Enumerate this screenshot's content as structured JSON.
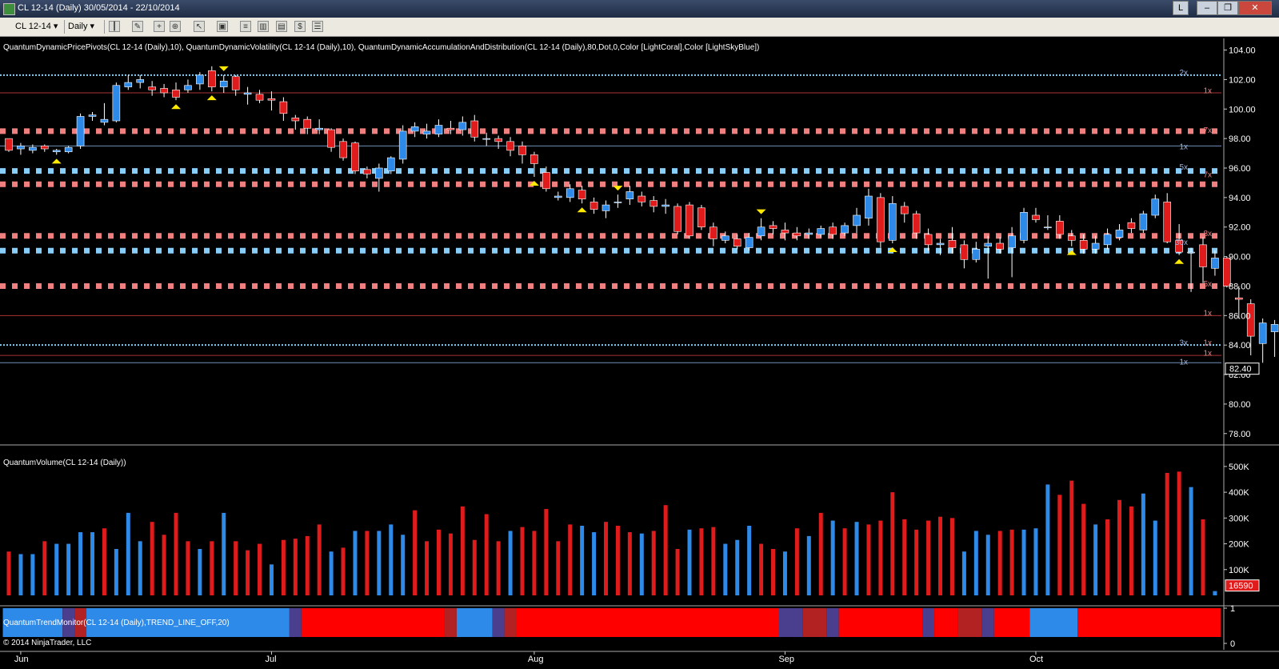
{
  "window": {
    "title": "CL 12-14 (Daily)  30/05/2014 - 22/10/2014",
    "buttons": {
      "layout": "L",
      "minimize": "–",
      "maximize": "❐",
      "close": "✕"
    }
  },
  "toolbar": {
    "instrument": "CL 12-14",
    "instrument_arrow": "▾",
    "period": "Daily",
    "period_arrow": "▾",
    "icons": [
      "bar-style-icon",
      "pencil-icon",
      "crosshair-icon",
      "zoom-icon",
      "pointer-icon",
      "properties-icon",
      "indicators-icon",
      "strategy-icon",
      "data-box-icon",
      "dollar-icon",
      "template-icon"
    ]
  },
  "colors": {
    "up": "#2e8ae8",
    "down": "#e01b1b",
    "coral": "#f08080",
    "skyblue": "#87cefa",
    "trend_red": "#ff0000",
    "trend_blue": "#2e8ae8",
    "trend_purple": "#4a3f8f",
    "trend_maroon": "#b22222"
  },
  "chart_data": [
    {
      "type": "candlestick",
      "title": "QuantumDynamicPricePivots(CL 12-14 (Daily),10), QuantumDynamicVolatility(CL 12-14 (Daily),10), QuantumDynamicAccumulationAndDistribution(CL 12-14 (Daily),80,Dot,0,Color [LightCoral],Color [LightSkyBlue])",
      "ylim": [
        77.5,
        104.3
      ],
      "yticks": [
        "104.00",
        "102.00",
        "100.00",
        "98.00",
        "96.00",
        "94.00",
        "92.00",
        "90.00",
        "88.00",
        "86.00",
        "84.00",
        "82.00",
        "80.00",
        "78.00"
      ],
      "last_price": "82.40",
      "candles": [
        [
          98.0,
          97.2,
          97.6,
          97.1
        ],
        [
          97.3,
          97.5,
          97.7,
          96.9
        ],
        [
          97.2,
          97.4,
          97.6,
          97.0
        ],
        [
          97.5,
          97.3,
          97.6,
          97.1
        ],
        [
          97.1,
          97.2,
          97.3,
          96.9
        ],
        [
          97.1,
          97.4,
          97.5,
          97.0
        ],
        [
          97.5,
          99.5,
          99.7,
          97.3
        ],
        [
          99.5,
          99.6,
          99.8,
          99.2
        ],
        [
          99.1,
          99.3,
          100.4,
          98.9
        ],
        [
          99.2,
          101.6,
          101.8,
          99.1
        ],
        [
          101.5,
          101.8,
          102.3,
          101.3
        ],
        [
          101.8,
          102.0,
          102.3,
          101.4
        ],
        [
          101.5,
          101.3,
          101.9,
          100.9
        ],
        [
          101.4,
          101.1,
          101.7,
          100.8
        ],
        [
          101.3,
          100.8,
          101.8,
          100.6
        ],
        [
          101.3,
          101.6,
          102.0,
          101.1
        ],
        [
          101.7,
          102.3,
          102.5,
          101.3
        ],
        [
          102.6,
          101.5,
          102.9,
          101.2
        ],
        [
          101.5,
          101.9,
          102.3,
          101.1
        ],
        [
          102.2,
          101.3,
          102.3,
          100.9
        ],
        [
          101.0,
          101.1,
          101.5,
          100.3
        ],
        [
          101.0,
          100.6,
          101.3,
          100.4
        ],
        [
          100.7,
          100.6,
          101.2,
          99.9
        ],
        [
          100.5,
          99.7,
          100.8,
          99.2
        ],
        [
          99.4,
          99.2,
          99.6,
          98.6
        ],
        [
          99.3,
          98.7,
          99.5,
          98.3
        ],
        [
          98.6,
          98.7,
          99.3,
          98.3
        ],
        [
          98.6,
          97.4,
          98.7,
          97.1
        ],
        [
          97.8,
          96.7,
          98.0,
          96.5
        ],
        [
          97.7,
          95.8,
          97.8,
          95.6
        ],
        [
          95.9,
          95.6,
          96.1,
          95.3
        ],
        [
          95.3,
          96.0,
          96.3,
          94.4
        ],
        [
          95.8,
          96.7,
          96.8,
          95.6
        ],
        [
          96.6,
          98.5,
          98.9,
          96.3
        ],
        [
          98.5,
          98.8,
          99.1,
          98.1
        ],
        [
          98.3,
          98.5,
          99.0,
          98.0
        ],
        [
          98.3,
          98.9,
          99.3,
          98.1
        ],
        [
          98.7,
          98.6,
          99.2,
          98.3
        ],
        [
          98.6,
          99.1,
          99.5,
          98.2
        ],
        [
          99.2,
          98.1,
          99.6,
          97.8
        ],
        [
          98.0,
          98.0,
          98.4,
          97.5
        ],
        [
          98.0,
          97.8,
          98.2,
          97.3
        ],
        [
          97.8,
          97.2,
          98.1,
          96.8
        ],
        [
          97.5,
          96.9,
          97.8,
          96.3
        ],
        [
          96.9,
          96.3,
          97.1,
          95.4
        ],
        [
          95.7,
          94.6,
          96.1,
          94.4
        ],
        [
          94.0,
          94.1,
          94.4,
          93.8
        ],
        [
          94.0,
          94.6,
          94.9,
          93.7
        ],
        [
          94.5,
          93.9,
          94.8,
          93.6
        ],
        [
          93.7,
          93.2,
          94.0,
          92.9
        ],
        [
          93.1,
          93.5,
          93.8,
          92.6
        ],
        [
          93.7,
          93.7,
          94.2,
          93.3
        ],
        [
          93.9,
          94.4,
          94.8,
          93.5
        ],
        [
          94.1,
          93.7,
          94.4,
          93.4
        ],
        [
          93.8,
          93.4,
          94.1,
          93.0
        ],
        [
          93.4,
          93.5,
          93.9,
          92.9
        ],
        [
          93.4,
          91.7,
          93.6,
          91.5
        ],
        [
          93.5,
          91.4,
          93.7,
          91.2
        ],
        [
          93.3,
          92.0,
          93.5,
          91.8
        ],
        [
          92.0,
          91.2,
          92.3,
          90.7
        ],
        [
          91.1,
          91.4,
          91.7,
          90.9
        ],
        [
          91.2,
          90.7,
          91.5,
          90.5
        ],
        [
          90.6,
          91.3,
          91.6,
          90.4
        ],
        [
          91.4,
          92.0,
          92.6,
          91.1
        ],
        [
          92.1,
          91.9,
          92.4,
          91.5
        ],
        [
          91.8,
          91.6,
          92.3,
          91.1
        ],
        [
          91.6,
          91.4,
          92.0,
          91.1
        ],
        [
          91.5,
          91.6,
          91.9,
          91.2
        ],
        [
          91.5,
          91.9,
          92.1,
          91.3
        ],
        [
          92.0,
          91.5,
          92.3,
          91.2
        ],
        [
          91.6,
          92.1,
          92.3,
          91.4
        ],
        [
          92.1,
          92.8,
          93.3,
          91.6
        ],
        [
          92.6,
          94.1,
          94.6,
          92.1
        ],
        [
          94.0,
          91.0,
          94.3,
          90.6
        ],
        [
          91.1,
          93.6,
          94.1,
          90.9
        ],
        [
          93.4,
          92.9,
          93.7,
          92.3
        ],
        [
          92.9,
          91.6,
          93.1,
          91.2
        ],
        [
          91.5,
          90.8,
          91.9,
          90.4
        ],
        [
          90.8,
          90.9,
          91.2,
          90.1
        ],
        [
          91.1,
          90.6,
          92.0,
          90.2
        ],
        [
          90.8,
          89.8,
          91.1,
          89.2
        ],
        [
          89.8,
          90.5,
          91.0,
          89.6
        ],
        [
          90.7,
          90.9,
          91.4,
          88.5
        ],
        [
          90.9,
          90.5,
          91.3,
          90.2
        ],
        [
          90.6,
          91.4,
          92.0,
          88.6
        ],
        [
          91.1,
          93.0,
          93.3,
          90.9
        ],
        [
          92.8,
          92.5,
          93.3,
          92.3
        ],
        [
          92.0,
          92.0,
          92.8,
          91.8
        ],
        [
          92.4,
          91.5,
          92.8,
          91.2
        ],
        [
          91.4,
          91.1,
          91.8,
          90.7
        ],
        [
          91.1,
          90.5,
          91.5,
          90.2
        ],
        [
          90.5,
          90.9,
          91.4,
          90.2
        ],
        [
          90.8,
          91.5,
          91.9,
          90.5
        ],
        [
          91.3,
          91.8,
          92.2,
          91.1
        ],
        [
          92.3,
          91.9,
          92.6,
          91.6
        ],
        [
          91.8,
          92.9,
          93.1,
          91.6
        ],
        [
          92.8,
          93.9,
          94.2,
          92.6
        ],
        [
          93.7,
          91.0,
          94.3,
          90.9
        ],
        [
          91.1,
          90.3,
          92.2,
          90.1
        ],
        [
          90.3,
          90.3,
          90.6,
          87.6
        ],
        [
          90.8,
          89.3,
          91.3,
          88.2
        ],
        [
          89.2,
          89.9,
          90.4,
          88.7
        ],
        [
          89.9,
          88.0,
          90.0,
          87.9
        ],
        [
          87.2,
          87.1,
          88.0,
          85.8
        ],
        [
          86.8,
          84.6,
          87.1,
          83.3
        ],
        [
          84.1,
          85.5,
          85.8,
          82.8
        ],
        [
          84.9,
          85.4,
          85.7,
          83.2
        ],
        [
          84.2,
          80.9,
          84.8,
          80.6
        ],
        [
          81.3,
          80.8,
          81.5,
          79.3
        ],
        [
          80.5,
          82.1,
          83.7,
          79.1
        ],
        [
          82.2,
          82.5,
          83.6,
          81.3
        ],
        [
          82.6,
          82.2,
          83.2,
          81.8
        ],
        [
          81.9,
          82.6,
          83.0,
          81.4
        ],
        [
          82.6,
          82.5,
          82.8,
          82.2
        ]
      ],
      "coral_levels": [
        98.5,
        94.9,
        91.4,
        88.0
      ],
      "skyblue_levels": [
        95.8,
        90.4
      ],
      "skyblue_thin": [
        102.3,
        84.0
      ],
      "red_thin": [
        101.1,
        86.0,
        83.3
      ],
      "blue_thin": [
        97.5,
        82.8
      ],
      "level_labels": [
        {
          "text": "2x",
          "y": 102.5,
          "c": "b"
        },
        {
          "text": "1x",
          "y": 101.3,
          "c": "r"
        },
        {
          "text": "7x",
          "y": 98.6,
          "c": "r"
        },
        {
          "text": "1x",
          "y": 97.5,
          "c": "b"
        },
        {
          "text": "5x",
          "y": 96.1,
          "c": "b"
        },
        {
          "text": "7x",
          "y": 95.6,
          "c": "r"
        },
        {
          "text": "8x",
          "y": 91.6,
          "c": "r"
        },
        {
          "text": "30x",
          "y": 91.0,
          "c": "b"
        },
        {
          "text": "5x",
          "y": 88.2,
          "c": "r"
        },
        {
          "text": "1x",
          "y": 86.2,
          "c": "r"
        },
        {
          "text": "3x",
          "y": 84.2,
          "c": "b"
        },
        {
          "text": "1x",
          "y": 84.2,
          "c": "r"
        },
        {
          "text": "1x",
          "y": 83.5,
          "c": "r"
        },
        {
          "text": "1x",
          "y": 82.9,
          "c": "b"
        }
      ],
      "pivots_high": [
        18,
        51,
        63
      ],
      "pivots_low": [
        4,
        14,
        17,
        44,
        48,
        74,
        89,
        98
      ]
    },
    {
      "type": "bar",
      "title": "QuantumVolume(CL 12-14 (Daily))",
      "ylim": [
        0,
        540000
      ],
      "yticks": [
        "500K",
        "400K",
        "300K",
        "200K",
        "100K"
      ],
      "last_value": "16590",
      "values": [
        170000,
        160000,
        160000,
        210000,
        200000,
        200000,
        245000,
        245000,
        260000,
        180000,
        320000,
        210000,
        285000,
        235000,
        320000,
        210000,
        180000,
        210000,
        320000,
        210000,
        175000,
        200000,
        120000,
        215000,
        220000,
        230000,
        275000,
        170000,
        185000,
        250000,
        250000,
        250000,
        275000,
        235000,
        330000,
        210000,
        255000,
        240000,
        345000,
        215000,
        315000,
        210000,
        250000,
        265000,
        250000,
        335000,
        210000,
        275000,
        270000,
        245000,
        285000,
        270000,
        245000,
        240000,
        250000,
        350000,
        180000,
        255000,
        260000,
        265000,
        200000,
        215000,
        270000,
        200000,
        180000,
        170000,
        260000,
        230000,
        320000,
        290000,
        260000,
        285000,
        275000,
        290000,
        400000,
        295000,
        255000,
        290000,
        305000,
        300000,
        170000,
        250000,
        235000,
        250000,
        255000,
        255000,
        260000,
        430000,
        390000,
        445000,
        355000,
        275000,
        295000,
        370000,
        345000,
        395000,
        290000,
        475000,
        480000,
        420000,
        295000,
        16590
      ],
      "dir": [
        0,
        1,
        1,
        0,
        1,
        1,
        1,
        1,
        0,
        1,
        1,
        1,
        0,
        0,
        0,
        0,
        1,
        0,
        1,
        0,
        0,
        0,
        1,
        0,
        0,
        0,
        0,
        1,
        0,
        1,
        0,
        1,
        1,
        1,
        0,
        0,
        0,
        0,
        0,
        0,
        0,
        0,
        1,
        0,
        0,
        0,
        0,
        0,
        1,
        1,
        0,
        0,
        0,
        1,
        0,
        0,
        0,
        1,
        0,
        0,
        1,
        1,
        1,
        0,
        0,
        1,
        0,
        1,
        0,
        1,
        0,
        1,
        0,
        0,
        0,
        0,
        0,
        0,
        0,
        0,
        1,
        1,
        1,
        0,
        0,
        1,
        1,
        1,
        0,
        0,
        0,
        1,
        0,
        0,
        0,
        1,
        1,
        0,
        0,
        1,
        0,
        1
      ]
    },
    {
      "type": "band",
      "title": "QuantumTrendMonitor(CL 12-14 (Daily),TREND_LINE_OFF,20)",
      "yticks": [
        "1",
        "0"
      ],
      "segments": [
        [
          0,
          5,
          "b"
        ],
        [
          5,
          6,
          "p"
        ],
        [
          6,
          7,
          "m"
        ],
        [
          7,
          24,
          "b"
        ],
        [
          24,
          25,
          "p"
        ],
        [
          25,
          37,
          "r"
        ],
        [
          37,
          38,
          "m"
        ],
        [
          38,
          41,
          "b"
        ],
        [
          41,
          42,
          "p"
        ],
        [
          42,
          43,
          "m"
        ],
        [
          43,
          65,
          "r"
        ],
        [
          65,
          67,
          "p"
        ],
        [
          67,
          69,
          "m"
        ],
        [
          69,
          70,
          "p"
        ],
        [
          70,
          77,
          "r"
        ],
        [
          77,
          78,
          "p"
        ],
        [
          78,
          80,
          "r"
        ],
        [
          80,
          82,
          "m"
        ],
        [
          82,
          83,
          "p"
        ],
        [
          83,
          86,
          "r"
        ],
        [
          86,
          90,
          "b"
        ],
        [
          90,
          102,
          "r"
        ]
      ]
    }
  ],
  "x_axis": {
    "labels": [
      "Jun",
      "Jul",
      "Aug",
      "Sep",
      "Oct"
    ],
    "positions": [
      1,
      22,
      44,
      65,
      86
    ]
  },
  "copyright": "© 2014 NinjaTrader, LLC"
}
